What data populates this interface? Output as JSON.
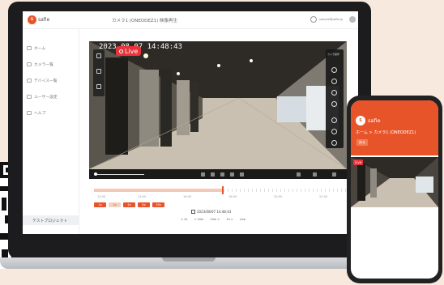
{
  "app": {
    "logo_text": "safie",
    "brand": "safie",
    "breadcrumb": "カメラ1 (ONEODEZ1) 映像再生",
    "user_email": "sample@safie.jp"
  },
  "sidebar": {
    "items": [
      {
        "label": "ホーム"
      },
      {
        "label": "カメラ一覧"
      },
      {
        "label": "デバイス一覧"
      },
      {
        "label": "ユーザー設定"
      },
      {
        "label": "ヘルプ"
      }
    ],
    "project": "テストプロジェクト"
  },
  "player": {
    "timestamp": "2023-08-07 14:48:43",
    "live_label": "Live",
    "panel_title": "カメラ操作"
  },
  "timeline": {
    "labels": [
      "12:00",
      "14:00",
      "16:00",
      "18:00",
      "20:00",
      "22:00"
    ],
    "speed_buttons": [
      "1x",
      "2x",
      "4x",
      "8x",
      "16x"
    ]
  },
  "date_row": "2023/08/07 14:48:43",
  "nav_row": [
    "< 1h",
    "< 10m",
    "10m >",
    "1h >",
    "Live"
  ],
  "phone": {
    "brand": "safie",
    "breadcrumb": "ホーム > カメラ1 (ONEODEZ1)",
    "back_label": "戻る",
    "live_label": "Live"
  },
  "colors": {
    "accent": "#e8542a",
    "live": "#e8333a",
    "background": "#f7e9de"
  }
}
